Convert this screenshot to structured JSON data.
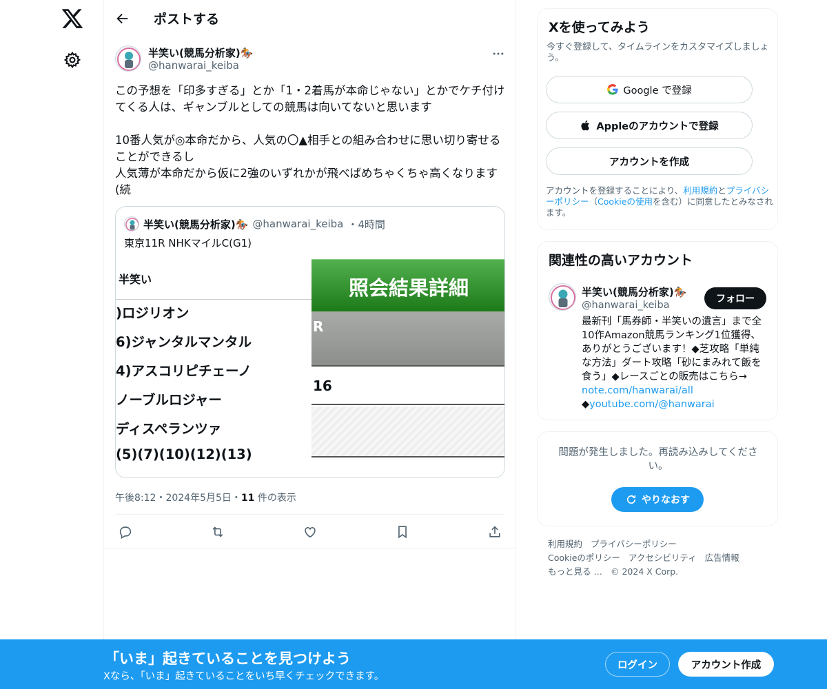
{
  "nav": {
    "logo_icon": "x-logo-icon",
    "settings_icon": "gear-icon"
  },
  "header": {
    "title": "ポストする"
  },
  "tweet": {
    "author_name": "半笑い(競馬分析家)🏇",
    "author_handle": "@hanwarai_keiba",
    "text": "この予想を「印多すぎる」とか「1・2着馬が本命じゃない」とかでケチ付けてくる人は、ギャンブルとしての競馬は向いてないと思います\n\n10番人気が◎本命だから、人気の〇▲相手との組み合わせに思い切り寄せることができるし\n人気薄が本命だから仮に2強のいずれかが飛べばめちゃくちゃ高くなります(続",
    "timestamp": "午後8:12・2024年5月5日・",
    "views_count": "11",
    "views_label": " 件の表示"
  },
  "quote": {
    "author_name": "半笑い(競馬分析家)🏇",
    "author_handle": "@hanwarai_keiba",
    "time": "・4時間",
    "text": "東京11R NHKマイルC(G1)",
    "media": {
      "header_label": "半笑い",
      "rows": [
        ")ロジリオン",
        "6)ジャンタルマンタル",
        "4)アスコリピチェーノ",
        "ノーブルロジャー",
        "ディスペランツァ",
        "(5)(7)(10)(12)(13)"
      ],
      "panel_title": "照会結果詳細",
      "panel_gray_text": "R",
      "panel_white_text": "16"
    }
  },
  "signup": {
    "title": "Xを使ってみよう",
    "subtitle": "今すぐ登録して、タイムラインをカスタマイズしましょう。",
    "google_label": "Google で登録",
    "apple_label": "Appleのアカウントで登録",
    "create_label": "アカウントを作成",
    "terms_prefix": "アカウントを登録することにより、",
    "terms_link": "利用規約",
    "terms_and": "と",
    "privacy_link": "プライバシーポリシー",
    "terms_paren_open": "（",
    "cookie_link": "Cookieの使用",
    "terms_suffix": "を含む）に同意したとみなされます。"
  },
  "related": {
    "title": "関連性の高いアカウント",
    "name": "半笑い(競馬分析家)🏇",
    "handle": "@hanwarai_keiba",
    "follow_label": "フォロー",
    "bio": "最新刊「馬券師・半笑いの遺言」まで全10作Amazon競馬ランキング1位獲得、ありがとうございます！◆芝攻略「単純な方法」ダート攻略「砂にまみれて飯を食う」◆レースごとの販売はこちら→ ",
    "link1": "note.com/hanwarai/all",
    "bio2": "◆",
    "link2": "youtube.com/@hanwarai"
  },
  "error": {
    "text": "問題が発生しました。再読み込みしてください。",
    "retry_label": "やりなおす"
  },
  "footer": {
    "links": [
      "利用規約",
      "プライバシーポリシー",
      "Cookieのポリシー",
      "アクセシビリティ",
      "広告情報",
      "もっと見る …"
    ],
    "copyright": "© 2024 X Corp."
  },
  "banner": {
    "title": "「いま」起きていることを見つけよう",
    "subtitle": "Xなら、「いま」起きていることをいち早くチェックできます。",
    "login_label": "ログイン",
    "create_label": "アカウント作成"
  },
  "colors": {
    "accent": "#1d9bf0",
    "text": "#0f1419",
    "muted": "#536471",
    "border": "#cfd9de"
  }
}
